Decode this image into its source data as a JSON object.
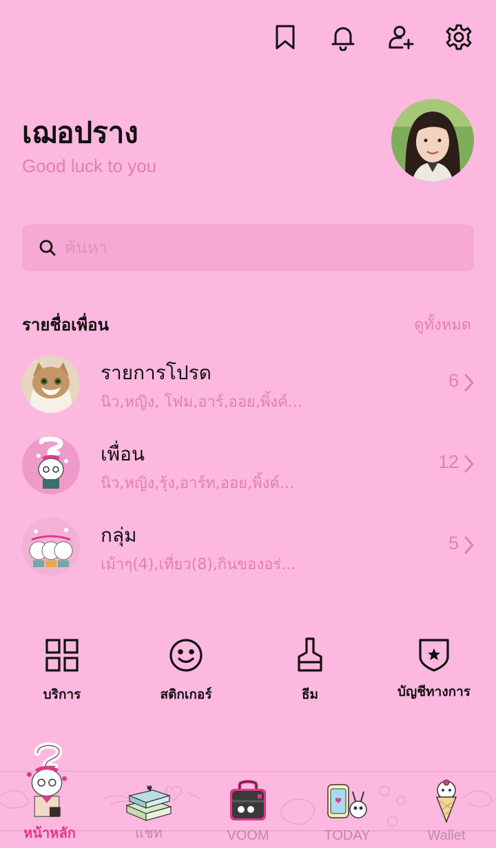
{
  "top_icons": [
    "bookmark-icon",
    "bell-icon",
    "add-friend-icon",
    "gear-icon"
  ],
  "profile": {
    "name": "เฌอปราง",
    "status": "Good luck to you"
  },
  "search": {
    "placeholder": "ค้นหา"
  },
  "friends_section": {
    "title": "รายชื่อเพื่อน",
    "see_all": "ดูทั้งหมด",
    "items": [
      {
        "title": "รายการโปรด",
        "sub": "นิว,หญิง, โฟม,อาร์,ออย,พิ้งค์...",
        "count": "6"
      },
      {
        "title": "เพื่อน",
        "sub": "นิว,หญิง,รุ้ง,อาร์ท,ออย,พิ้งค์...",
        "count": "12"
      },
      {
        "title": "กลุ่ม",
        "sub": "เม้าๆ(4),เที่ยว(8),กินของอร่...",
        "count": "5"
      }
    ]
  },
  "shortcuts": [
    {
      "label": "บริการ",
      "icon": "grid-icon"
    },
    {
      "label": "สติกเกอร์",
      "icon": "smiley-icon"
    },
    {
      "label": "ธีม",
      "icon": "brush-icon"
    },
    {
      "label": "บัญชีทางการ",
      "icon": "shield-star-icon"
    }
  ],
  "bottom_nav": [
    {
      "label": "หน้าหลัก",
      "active": true
    },
    {
      "label": "แชท",
      "active": false
    },
    {
      "label": "VOOM",
      "active": false
    },
    {
      "label": "TODAY",
      "active": false
    },
    {
      "label": "Wallet",
      "active": false
    }
  ],
  "colors": {
    "background": "#fdb8df",
    "accent_text": "#e27fb2",
    "search_bg": "#f5a9d3",
    "active_tab": "#e0388a"
  }
}
